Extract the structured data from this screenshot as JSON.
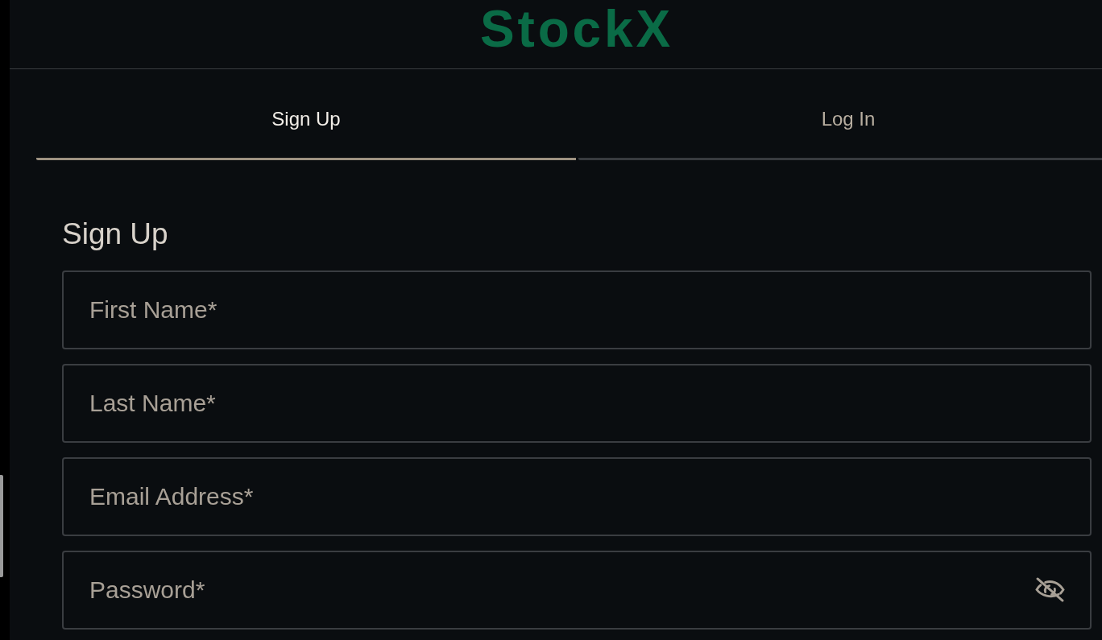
{
  "logo": {
    "text": "StockX"
  },
  "tabs": [
    {
      "label": "Sign Up",
      "selected": true
    },
    {
      "label": "Log In",
      "selected": false
    }
  ],
  "form": {
    "heading": "Sign Up",
    "fields": [
      {
        "kind": "text",
        "placeholder": "First Name*"
      },
      {
        "kind": "text",
        "placeholder": "Last Name*"
      },
      {
        "kind": "text",
        "placeholder": "Email Address*"
      },
      {
        "kind": "password",
        "placeholder": "Password*"
      }
    ]
  }
}
